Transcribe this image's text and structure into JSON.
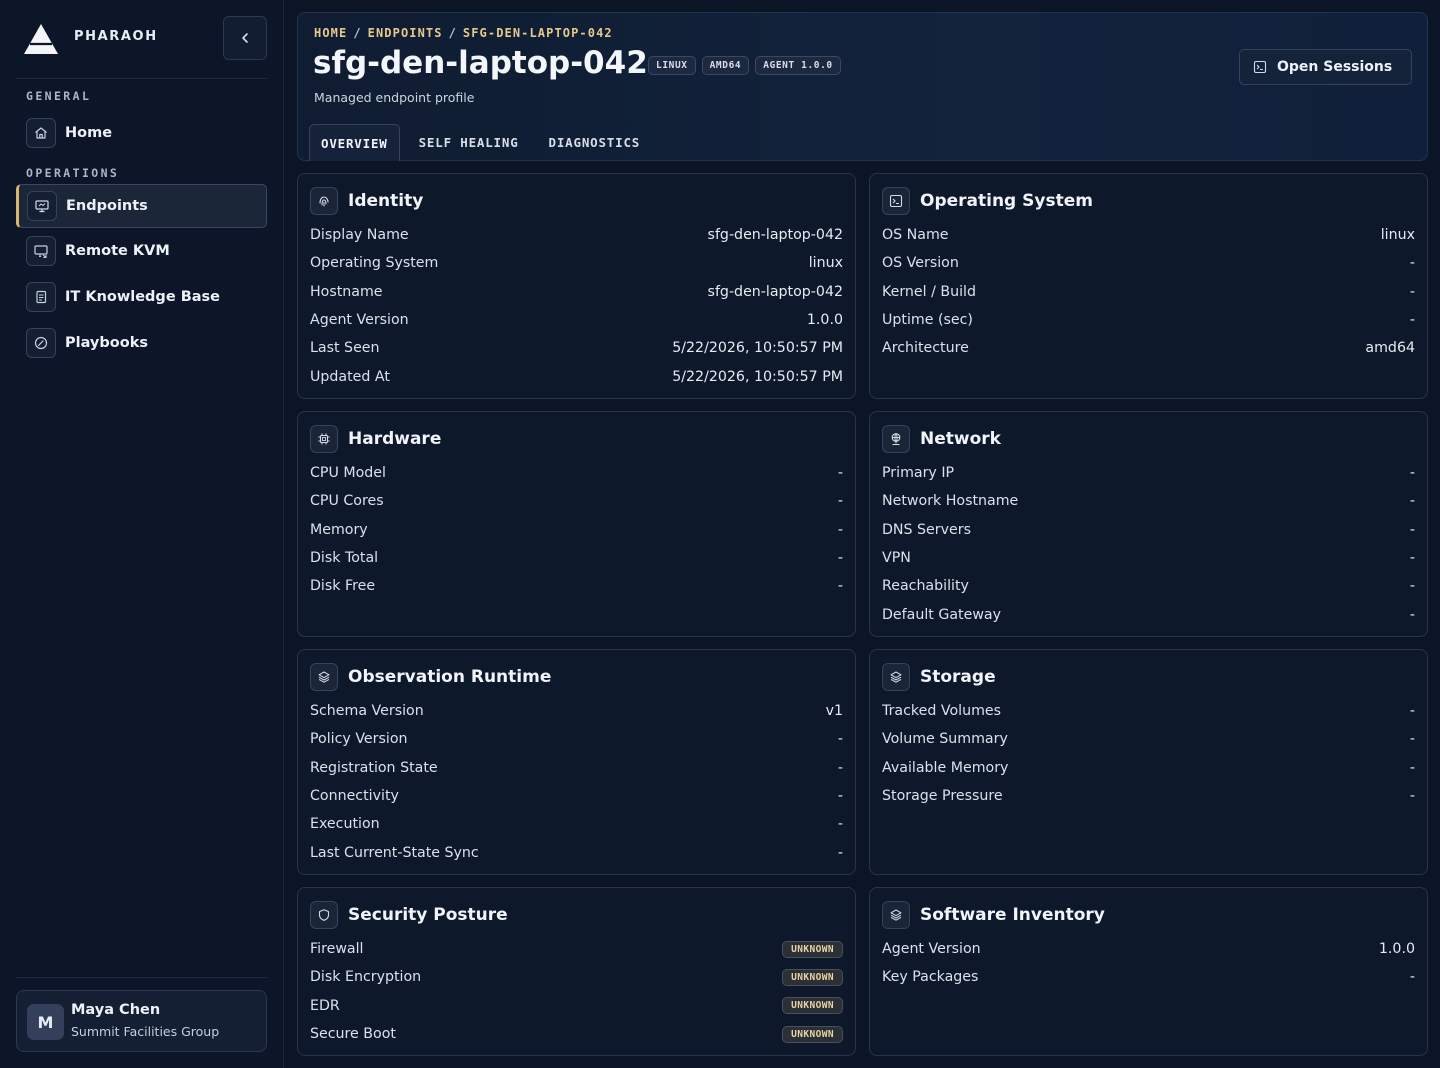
{
  "brand": {
    "name": "PHARAOH"
  },
  "sidebar": {
    "sections": [
      {
        "label": "GENERAL",
        "items": [
          {
            "label": "Home",
            "icon": "home-icon"
          }
        ]
      },
      {
        "label": "OPERATIONS",
        "items": [
          {
            "label": "Endpoints",
            "icon": "monitor-icon",
            "active": true
          },
          {
            "label": "Remote KVM",
            "icon": "remote-screen-icon"
          },
          {
            "label": "IT Knowledge Base",
            "icon": "book-icon"
          },
          {
            "label": "Playbooks",
            "icon": "gauge-icon"
          }
        ]
      }
    ]
  },
  "user": {
    "initial": "M",
    "name": "Maya Chen",
    "org": "Summit Facilities Group"
  },
  "header": {
    "breadcrumb": [
      "HOME",
      "ENDPOINTS",
      "SFG-DEN-LAPTOP-042"
    ],
    "title": "sfg-den-laptop-042",
    "badges": [
      "LINUX",
      "AMD64",
      "AGENT 1.0.0"
    ],
    "subtitle": "Managed endpoint profile",
    "open_sessions_label": "Open Sessions",
    "tabs": [
      "OVERVIEW",
      "SELF HEALING",
      "DIAGNOSTICS"
    ]
  },
  "cards": {
    "identity": {
      "title": "Identity",
      "rows": [
        {
          "k": "Display Name",
          "v": "sfg-den-laptop-042"
        },
        {
          "k": "Operating System",
          "v": "linux"
        },
        {
          "k": "Hostname",
          "v": "sfg-den-laptop-042"
        },
        {
          "k": "Agent Version",
          "v": "1.0.0"
        },
        {
          "k": "Last Seen",
          "v": "5/22/2026, 10:50:57 PM"
        },
        {
          "k": "Updated At",
          "v": "5/22/2026, 10:50:57 PM"
        }
      ]
    },
    "os": {
      "title": "Operating System",
      "rows": [
        {
          "k": "OS Name",
          "v": "linux"
        },
        {
          "k": "OS Version",
          "v": "-"
        },
        {
          "k": "Kernel / Build",
          "v": "-"
        },
        {
          "k": "Uptime (sec)",
          "v": "-"
        },
        {
          "k": "Architecture",
          "v": "amd64"
        }
      ]
    },
    "hardware": {
      "title": "Hardware",
      "rows": [
        {
          "k": "CPU Model",
          "v": "-"
        },
        {
          "k": "CPU Cores",
          "v": "-"
        },
        {
          "k": "Memory",
          "v": "-"
        },
        {
          "k": "Disk Total",
          "v": "-"
        },
        {
          "k": "Disk Free",
          "v": "-"
        }
      ]
    },
    "network": {
      "title": "Network",
      "rows": [
        {
          "k": "Primary IP",
          "v": "-"
        },
        {
          "k": "Network Hostname",
          "v": "-"
        },
        {
          "k": "DNS Servers",
          "v": "-"
        },
        {
          "k": "VPN",
          "v": "-"
        },
        {
          "k": "Reachability",
          "v": "-"
        },
        {
          "k": "Default Gateway",
          "v": "-"
        }
      ]
    },
    "runtime": {
      "title": "Observation Runtime",
      "rows": [
        {
          "k": "Schema Version",
          "v": "v1"
        },
        {
          "k": "Policy Version",
          "v": "-"
        },
        {
          "k": "Registration State",
          "v": "-"
        },
        {
          "k": "Connectivity",
          "v": "-"
        },
        {
          "k": "Execution",
          "v": "-"
        },
        {
          "k": "Last Current-State Sync",
          "v": "-"
        }
      ]
    },
    "storage": {
      "title": "Storage",
      "rows": [
        {
          "k": "Tracked Volumes",
          "v": "-"
        },
        {
          "k": "Volume Summary",
          "v": "-"
        },
        {
          "k": "Available Memory",
          "v": "-"
        },
        {
          "k": "Storage Pressure",
          "v": "-"
        }
      ]
    },
    "security": {
      "title": "Security Posture",
      "rows": [
        {
          "k": "Firewall",
          "v": "UNKNOWN"
        },
        {
          "k": "Disk Encryption",
          "v": "UNKNOWN"
        },
        {
          "k": "EDR",
          "v": "UNKNOWN"
        },
        {
          "k": "Secure Boot",
          "v": "UNKNOWN"
        }
      ]
    },
    "software": {
      "title": "Software Inventory",
      "rows": [
        {
          "k": "Agent Version",
          "v": "1.0.0"
        },
        {
          "k": "Key Packages",
          "v": "-"
        }
      ]
    }
  },
  "colors": {
    "accent": "#d8b66a",
    "background": "#0b1526",
    "card": "#0d182b"
  }
}
